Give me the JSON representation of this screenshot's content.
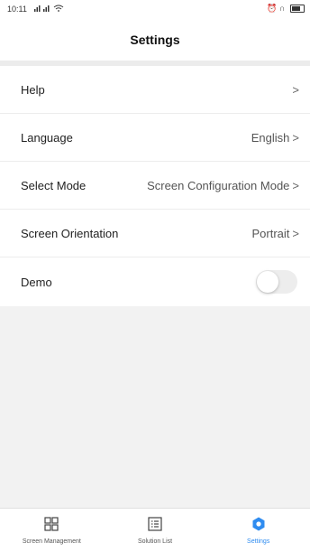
{
  "status_bar": {
    "time": "10:11",
    "signal": "ᵃᵢₗ ᵃᵢₗ ≋"
  },
  "header": {
    "title": "Settings"
  },
  "rows": [
    {
      "label": "Help",
      "value": ""
    },
    {
      "label": "Language",
      "value": "English"
    },
    {
      "label": "Select Mode",
      "value": "Screen Configuration Mode"
    },
    {
      "label": "Screen Orientation",
      "value": "Portrait"
    },
    {
      "label": "Demo",
      "toggle_on": false
    }
  ],
  "tabs": [
    {
      "label": "Screen Management",
      "icon": "grid-icon",
      "active": false
    },
    {
      "label": "Solution List",
      "icon": "list-icon",
      "active": false
    },
    {
      "label": "Settings",
      "icon": "gear-icon",
      "active": true
    }
  ],
  "colors": {
    "accent": "#2f8cf0",
    "background": "#f2f2f2"
  }
}
